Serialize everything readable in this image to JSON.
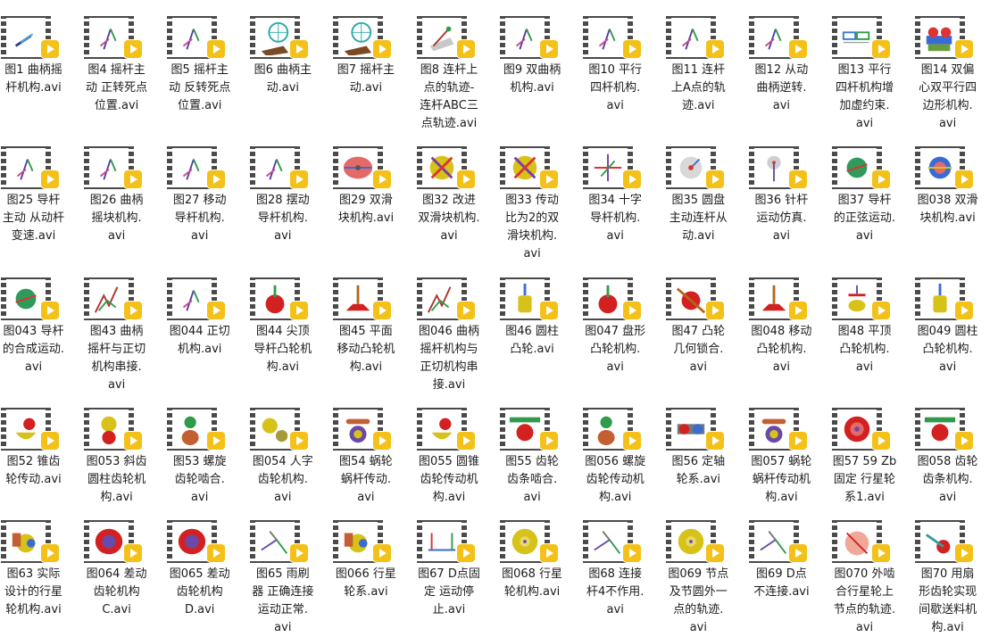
{
  "files": [
    {
      "label": "图1 曲柄摇\n杆机构.avi",
      "preview": "crank-rocker"
    },
    {
      "label": "图4 摇杆主\n动 正转死点\n位置.avi",
      "preview": "linkage"
    },
    {
      "label": "图5 摇杆主\n动 反转死点\n位置.avi",
      "preview": "linkage"
    },
    {
      "label": "图6 曲柄主\n动.avi",
      "preview": "wheel-mesh"
    },
    {
      "label": "图7 摇杆主\n动.avi",
      "preview": "wheel-mesh"
    },
    {
      "label": "图8 连杆上\n点的轨迹-\n连杆ABC三\n点轨迹.avi",
      "preview": "coupler"
    },
    {
      "label": "图9 双曲柄\n机构.avi",
      "preview": "linkage"
    },
    {
      "label": "图10 平行\n四杆机构.\navi",
      "preview": "linkage"
    },
    {
      "label": "图11 连杆\n上A点的轨\n迹.avi",
      "preview": "linkage"
    },
    {
      "label": "图12 从动\n曲柄逆转.\navi",
      "preview": "linkage"
    },
    {
      "label": "图13 平行\n四杆机构增\n加虚约束.\navi",
      "preview": "parallel"
    },
    {
      "label": "图14 双偏\n心双平行四\n边形机构.\navi",
      "preview": "double-eccentric"
    },
    {
      "label": "图25 导杆\n主动 从动杆\n变速.avi",
      "preview": "linkage"
    },
    {
      "label": "图26 曲柄\n摇块机构.\navi",
      "preview": "linkage"
    },
    {
      "label": "图27 移动\n导杆机构.\navi",
      "preview": "linkage"
    },
    {
      "label": "图28 摆动\n导杆机构.\navi",
      "preview": "linkage"
    },
    {
      "label": "图29 双滑\n块机构.avi",
      "preview": "ellipse-red"
    },
    {
      "label": "图32 改进\n双滑块机构.\navi",
      "preview": "cross-disk"
    },
    {
      "label": "图33 传动\n比为2的双\n滑块机构.\navi",
      "preview": "cross-disk"
    },
    {
      "label": "图34 十字\n导杆机构.\navi",
      "preview": "cross"
    },
    {
      "label": "图35 圆盘\n主动连杆从\n动.avi",
      "preview": "disk-grey"
    },
    {
      "label": "图36 针杆\n运动仿真.\navi",
      "preview": "needle"
    },
    {
      "label": "图37 导杆\n的正弦运动.\navi",
      "preview": "disk-green"
    },
    {
      "label": "图038 双滑\n块机构.avi",
      "preview": "disk-blue"
    },
    {
      "label": "图043 导杆\n的合成运动.\navi",
      "preview": "disk-green"
    },
    {
      "label": "图43 曲柄\n摇杆与正切\n机构串接.\navi",
      "preview": "zigzag"
    },
    {
      "label": "图044 正切\n机构.avi",
      "preview": "linkage"
    },
    {
      "label": "图44 尖顶\n导杆凸轮机\n构.avi",
      "preview": "cam-red"
    },
    {
      "label": "图45 平面\n移动凸轮机\n构.avi",
      "preview": "cam-flat"
    },
    {
      "label": "图046 曲柄\n摇杆机构与\n正切机构串\n接.avi",
      "preview": "zigzag"
    },
    {
      "label": "图46 圆柱\n凸轮.avi",
      "preview": "cylinder-cam"
    },
    {
      "label": "图047 盘形\n凸轮机构.\navi",
      "preview": "cam-red"
    },
    {
      "label": "图47 凸轮\n几何锁合.\navi",
      "preview": "cam-locked"
    },
    {
      "label": "图048 移动\n凸轮机构.\navi",
      "preview": "cam-flat"
    },
    {
      "label": "图48 平顶\n凸轮机构.\navi",
      "preview": "cam-flat-top"
    },
    {
      "label": "图049 圆柱\n凸轮机构.\navi",
      "preview": "cylinder-cam"
    },
    {
      "label": "图52 锥齿\n轮传动.avi",
      "preview": "bevel"
    },
    {
      "label": "图053 斜齿\n圆柱齿轮机\n构.avi",
      "preview": "gears-yellow"
    },
    {
      "label": "图53 螺旋\n齿轮啮合.\navi",
      "preview": "gears-green"
    },
    {
      "label": "图054 人字\n齿轮机构.\navi",
      "preview": "herringbone"
    },
    {
      "label": "图54 蜗轮\n蜗杆传动.\navi",
      "preview": "worm"
    },
    {
      "label": "图055 圆锥\n齿轮传动机\n构.avi",
      "preview": "bevel"
    },
    {
      "label": "图55 齿轮\n齿条啮合.\navi",
      "preview": "rack"
    },
    {
      "label": "图056 螺旋\n齿轮传动机\n构.avi",
      "preview": "gears-green"
    },
    {
      "label": "图56 定轴\n轮系.avi",
      "preview": "gear-train"
    },
    {
      "label": "图057 蜗轮\n蜗杆传动机\n构.avi",
      "preview": "worm"
    },
    {
      "label": "图57 59 Zb\n固定 行星轮\n系1.avi",
      "preview": "planetary-red"
    },
    {
      "label": "图058 齿轮\n齿条机构.\navi",
      "preview": "rack"
    },
    {
      "label": "图63 实际\n设计的行星\n轮机构.avi",
      "preview": "planetary-real"
    },
    {
      "label": "图064 差动\n齿轮机构\nC.avi",
      "preview": "differential"
    },
    {
      "label": "图065 差动\n齿轮机构\nD.avi",
      "preview": "differential"
    },
    {
      "label": "图65 雨刷\n器 正确连接\n运动正常.\navi",
      "preview": "wiper"
    },
    {
      "label": "图066 行星\n轮系.avi",
      "preview": "planetary-real"
    },
    {
      "label": "图67 D点固\n定 运动停\n止.avi",
      "preview": "frame-blue"
    },
    {
      "label": "图068 行星\n轮机构.avi",
      "preview": "planetary-yellow"
    },
    {
      "label": "图68 连接\n杆4不作用.\navi",
      "preview": "wiper"
    },
    {
      "label": "图069 节点\n及节圆外一\n点的轨迹.\navi",
      "preview": "planetary-yellow"
    },
    {
      "label": "图69 D点\n不连接.avi",
      "preview": "wiper"
    },
    {
      "label": "图070 外啮\n合行星轮上\n节点的轨迹.\navi",
      "preview": "planetary-pink"
    },
    {
      "label": "图70 用扇\n形齿轮实现\n间歇送料机\n构.avi",
      "preview": "sector-gear"
    }
  ]
}
